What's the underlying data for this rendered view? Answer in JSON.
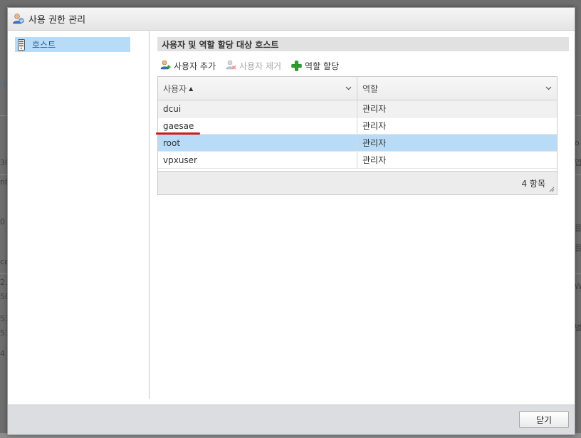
{
  "dialog": {
    "title": "사용 권한 관리",
    "close_label": "닫기"
  },
  "tree": {
    "items": [
      {
        "label": "호스트",
        "selected": true
      }
    ]
  },
  "section": {
    "title": "사용자 및 역할 할당 대상 호스트"
  },
  "toolbar": {
    "add_user": "사용자 추가",
    "remove_user": "사용자 제거",
    "assign_role": "역할 할당"
  },
  "grid": {
    "columns": [
      {
        "label": "사용자",
        "sort": "▲"
      },
      {
        "label": "역할"
      }
    ],
    "rows": [
      {
        "user": "dcui",
        "role": "관리자",
        "selected": false
      },
      {
        "user": "gaesae",
        "role": "관리자",
        "selected": false,
        "annotated": true
      },
      {
        "user": "root",
        "role": "관리자",
        "selected": true
      },
      {
        "user": "vpxuser",
        "role": "관리자",
        "selected": false
      }
    ],
    "count_label": "4 항목"
  },
  "background": {
    "left_fragments": [
      "네",
      "30",
      "nt",
      "0",
      "ca",
      "2.",
      "50",
      "53",
      "53",
      "4"
    ],
    "right_fragments": [
      "o",
      "엽",
      "를",
      "를",
      "W",
      "별"
    ]
  },
  "colors": {
    "selection": "#b8dcf8",
    "annotation_underline": "#d01a1a",
    "add_icon_green": "#2ca02c"
  }
}
